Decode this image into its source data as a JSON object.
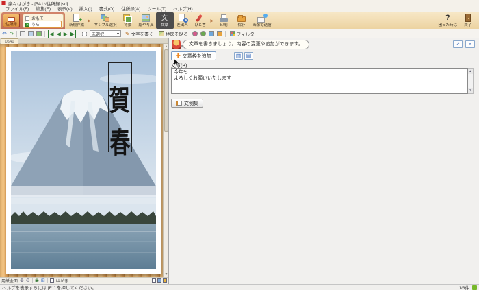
{
  "window": {
    "title": "楽々はがき - [5A1*/住所録.jsd]"
  },
  "menu": {
    "items": [
      "ファイル(F)",
      "編集(E)",
      "表示(V)",
      "挿入(I)",
      "書式(O)",
      "住所録(A)",
      "ツール(T)",
      "ヘルプ(H)"
    ]
  },
  "toolbar": {
    "address_book_label": "住所録",
    "front_label": "おもて",
    "back_label": "うら",
    "back_check": "✓",
    "new_label": "新規作成",
    "sample_label": "サンプル選択",
    "background_label": "背景",
    "pictures_label": "絵や写真",
    "text_label": "文章",
    "text_glyph": "文",
    "sender_label": "差出人",
    "hitokoto_label": "ひと言",
    "print_label": "印刷",
    "save_label": "保存",
    "send_image_label": "画像で送信",
    "help_icon_glyph": "?",
    "help_label": "困った時は",
    "exit_label": "終了"
  },
  "toolbar2": {
    "undo_glyph": "↶",
    "redo_glyph": "↷",
    "nav_first": "◀",
    "nav_prev": "◀",
    "nav_next": "▶",
    "nav_last": "▶",
    "unselected_label": "未選択",
    "combo_caret": "▾",
    "write_text_glyph": "✎",
    "write_text_label": "文字を書く",
    "paste_map_label": "地図を貼る",
    "filter_label": "フィルター"
  },
  "canvas": {
    "tab_label": "05A1",
    "calligraphy": "賀春",
    "footer": {
      "paper_label": "用紙全面",
      "zoom_in_glyph": "⊕",
      "zoom_out_glyph": "⊖",
      "view_glyph_1": "◉",
      "view_glyph_2": "⊞",
      "hagaki_label": "はがき"
    }
  },
  "panel": {
    "bubble_text": "文章を書きましょう。内容の変更や追加ができます。",
    "float_btn_glyph": "↗",
    "close_btn_glyph": "×",
    "add_frame_plus": "✚",
    "add_frame_label": "文章枠を追加",
    "vertical_dir_glyph": "▥",
    "horizontal_dir_glyph": "▤",
    "text_field_label": "文章(B)",
    "text_value": "今年も\nよろしくお願いいたします",
    "scroll_up": "▲",
    "scroll_down": "▼",
    "examples_label": "文例集"
  },
  "statusbar": {
    "help_text": "ヘルプを表示するには [F1] を押してください。",
    "count": "1/3件"
  }
}
